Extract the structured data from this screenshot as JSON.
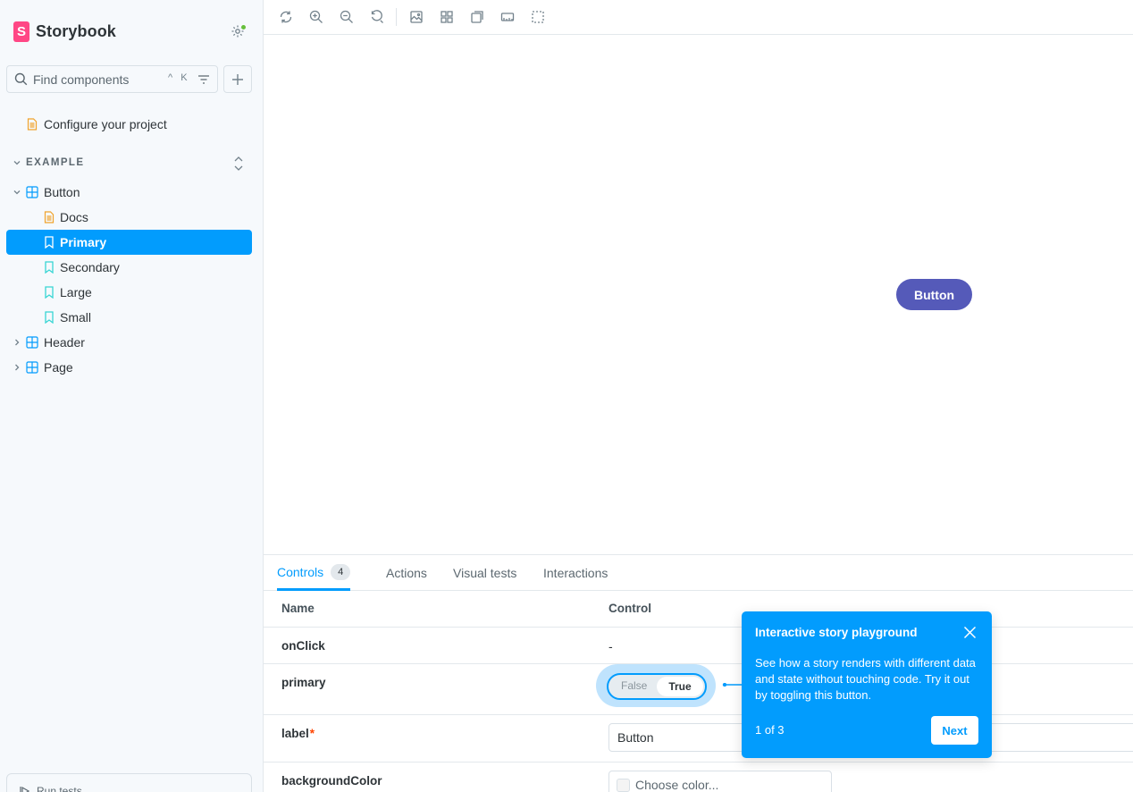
{
  "brand": {
    "name": "Storybook",
    "logo_letter": "S",
    "logo_color": "#ff4785"
  },
  "search": {
    "placeholder": "Find components",
    "shortcut": "^ K"
  },
  "sidebar": {
    "configure": "Configure your project",
    "section": "EXAMPLE",
    "items": [
      {
        "label": "Button",
        "type": "component",
        "expanded": true
      },
      {
        "label": "Docs",
        "type": "docs"
      },
      {
        "label": "Primary",
        "type": "story",
        "selected": true
      },
      {
        "label": "Secondary",
        "type": "story"
      },
      {
        "label": "Large",
        "type": "story"
      },
      {
        "label": "Small",
        "type": "story"
      },
      {
        "label": "Header",
        "type": "component",
        "expanded": false
      },
      {
        "label": "Page",
        "type": "component",
        "expanded": false
      }
    ],
    "run_tests": "Run tests",
    "accent_color": "#029cfd"
  },
  "toolbar": {
    "tools": [
      "reload-icon",
      "zoom-in-icon",
      "zoom-out-icon",
      "reset-zoom-icon",
      "background-icon",
      "grid-icon",
      "viewport-icon",
      "measure-icon",
      "outline-icon"
    ]
  },
  "preview": {
    "button_label": "Button",
    "button_color": "#555ab9"
  },
  "panel": {
    "tabs": [
      {
        "label": "Controls",
        "badge": "4",
        "active": true
      },
      {
        "label": "Actions"
      },
      {
        "label": "Visual tests"
      },
      {
        "label": "Interactions"
      }
    ],
    "columns": {
      "name": "Name",
      "control": "Control"
    },
    "rows": {
      "onclick": {
        "name": "onClick",
        "value": "-"
      },
      "primary": {
        "name": "primary",
        "false_label": "False",
        "true_label": "True"
      },
      "label": {
        "name": "label",
        "required": "*",
        "value": "Button"
      },
      "background": {
        "name": "backgroundColor",
        "placeholder": "Choose color..."
      }
    }
  },
  "tour": {
    "title": "Interactive story playground",
    "body": "See how a story renders with different data and state without touching code. Try it out by toggling this button.",
    "step": "1 of 3",
    "next": "Next"
  }
}
